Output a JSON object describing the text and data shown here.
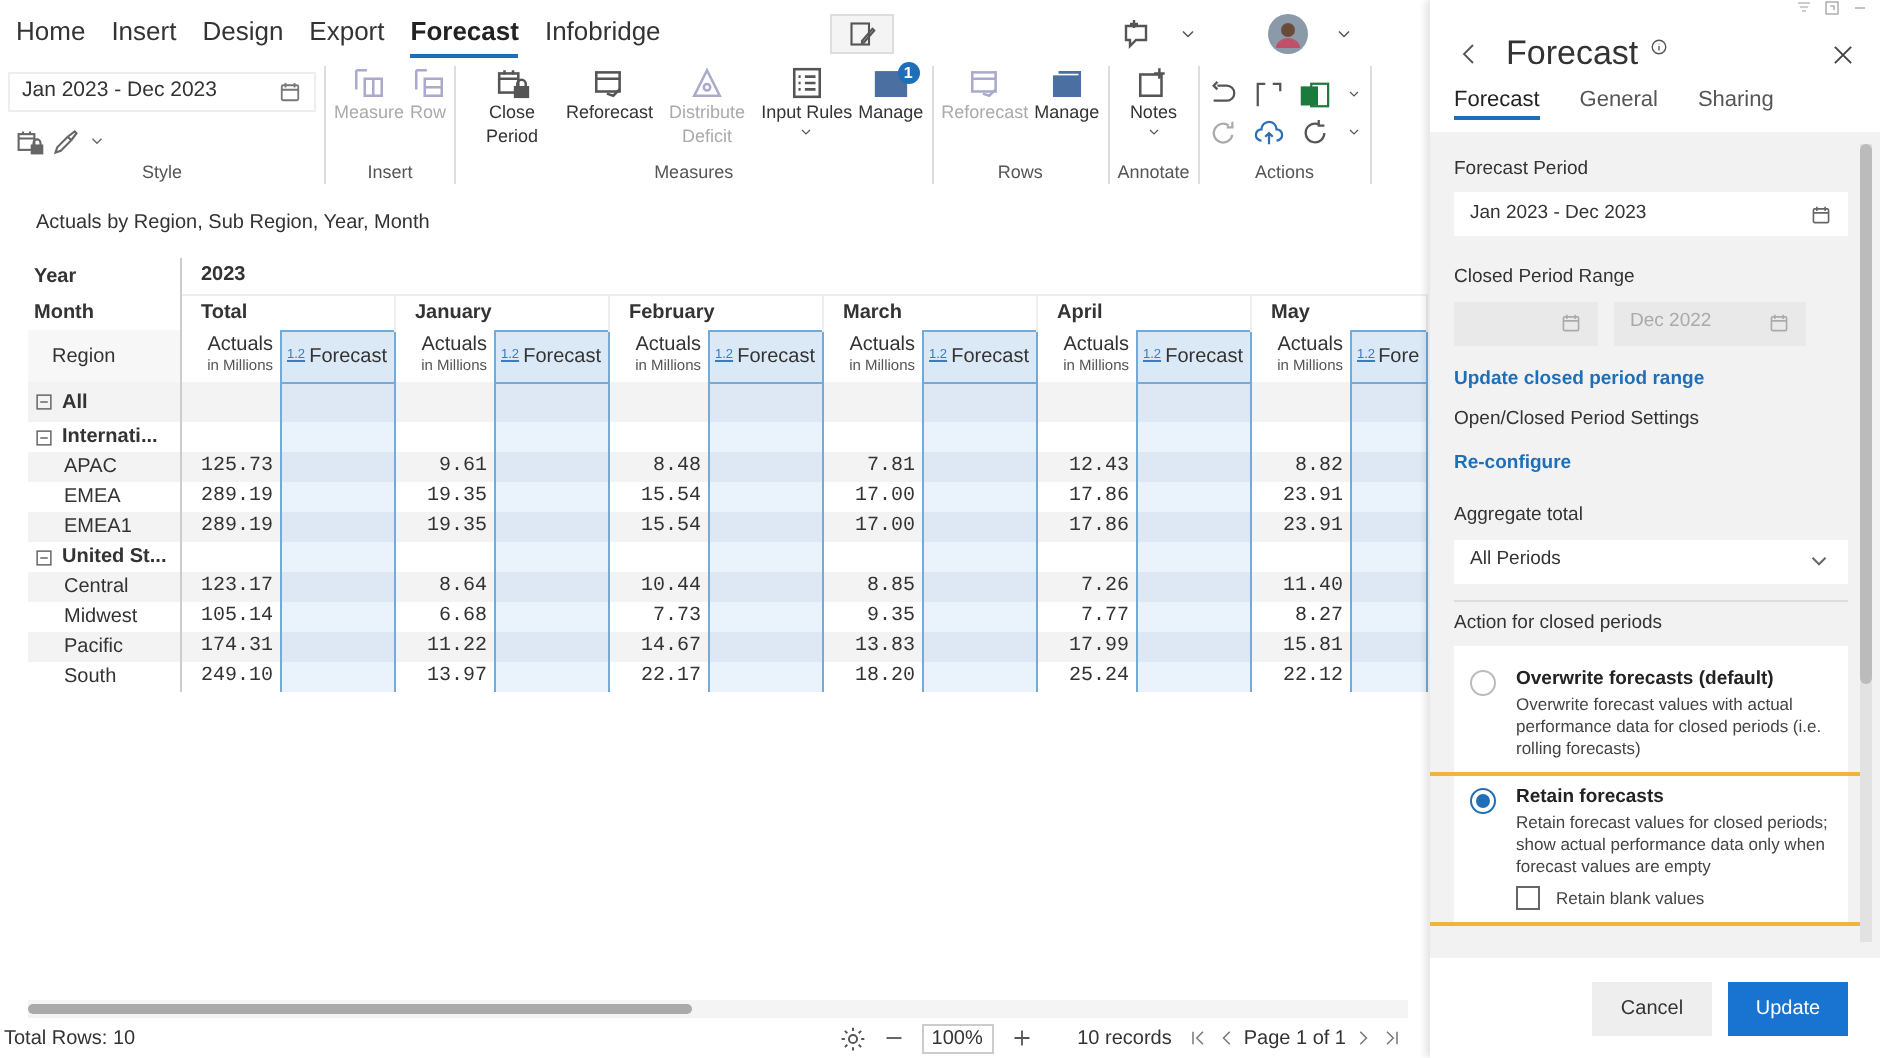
{
  "ribbon": {
    "tabs": [
      {
        "label": "Home",
        "selected": false
      },
      {
        "label": "Insert",
        "selected": false
      },
      {
        "label": "Design",
        "selected": false
      },
      {
        "label": "Export",
        "selected": false
      },
      {
        "label": "Forecast",
        "selected": true
      },
      {
        "label": "Infobridge",
        "selected": false
      }
    ],
    "groups": [
      {
        "kind": "style",
        "label": "Style",
        "date_range": "Jan 2023 - Dec 2023"
      },
      {
        "kind": "buttons",
        "label": "Insert",
        "buttons": [
          {
            "label": "Measure",
            "disabled": true
          },
          {
            "label": "Row",
            "disabled": true
          }
        ]
      },
      {
        "kind": "buttons",
        "label": "Measures",
        "buttons": [
          {
            "label": "Close Period",
            "disabled": false
          },
          {
            "label": "Reforecast",
            "disabled": false
          },
          {
            "label": "Distribute Deficit",
            "disabled": true
          },
          {
            "label": "Input Rules",
            "disabled": false,
            "dropdown": true
          },
          {
            "label": "Manage",
            "disabled": false,
            "badge": "1"
          }
        ]
      },
      {
        "kind": "buttons",
        "label": "Rows",
        "buttons": [
          {
            "label": "Reforecast",
            "disabled": true
          },
          {
            "label": "Manage",
            "disabled": false
          }
        ]
      },
      {
        "kind": "buttons",
        "label": "Annotate",
        "buttons": [
          {
            "label": "Notes",
            "disabled": false,
            "dropdown": true
          }
        ]
      },
      {
        "kind": "actions",
        "label": "Actions"
      }
    ]
  },
  "report": {
    "title": "Actuals by Region, Sub Region, Year, Month",
    "year_label": "Year",
    "year": "2023",
    "month_label": "Month",
    "region_label": "Region",
    "months": [
      {
        "name": "Total",
        "actuals": "Actuals",
        "unit": "in Millions",
        "format": "1.2",
        "forecast": "Forecast"
      },
      {
        "name": "January",
        "actuals": "Actuals",
        "unit": "in Millions",
        "format": "1.2",
        "forecast": "Forecast"
      },
      {
        "name": "February",
        "actuals": "Actuals",
        "unit": "in Millions",
        "format": "1.2",
        "forecast": "Forecast"
      },
      {
        "name": "March",
        "actuals": "Actuals",
        "unit": "in Millions",
        "format": "1.2",
        "forecast": "Forecast"
      },
      {
        "name": "April",
        "actuals": "Actuals",
        "unit": "in Millions",
        "format": "1.2",
        "forecast": "Forecast"
      },
      {
        "name": "May",
        "actuals": "Actuals",
        "unit": "in Millions",
        "format": "1.2",
        "forecast": "Fore"
      }
    ],
    "rows": [
      {
        "label": "All",
        "kind": "group",
        "expanded": true
      },
      {
        "label": "Internati...",
        "kind": "group",
        "expanded": true
      },
      {
        "label": "APAC",
        "kind": "leaf",
        "values": [
          "125.73",
          "9.61",
          "8.48",
          "7.81",
          "12.43",
          "8.82"
        ]
      },
      {
        "label": "EMEA",
        "kind": "leaf",
        "values": [
          "289.19",
          "19.35",
          "15.54",
          "17.00",
          "17.86",
          "23.91"
        ]
      },
      {
        "label": "EMEA1",
        "kind": "leaf",
        "values": [
          "289.19",
          "19.35",
          "15.54",
          "17.00",
          "17.86",
          "23.91"
        ]
      },
      {
        "label": "United St...",
        "kind": "group",
        "expanded": true
      },
      {
        "label": "Central",
        "kind": "leaf",
        "values": [
          "123.17",
          "8.64",
          "10.44",
          "8.85",
          "7.26",
          "11.40"
        ]
      },
      {
        "label": "Midwest",
        "kind": "leaf",
        "values": [
          "105.14",
          "6.68",
          "7.73",
          "9.35",
          "7.77",
          "8.27"
        ]
      },
      {
        "label": "Pacific",
        "kind": "leaf",
        "values": [
          "174.31",
          "11.22",
          "14.67",
          "13.83",
          "17.99",
          "15.81"
        ]
      },
      {
        "label": "South",
        "kind": "leaf",
        "values": [
          "249.10",
          "13.97",
          "22.17",
          "18.20",
          "25.24",
          "22.12"
        ]
      }
    ]
  },
  "status_bar": {
    "total_rows": "Total Rows: 10",
    "zoom": "100%",
    "records": "10 records",
    "page": "Page 1 of 1"
  },
  "panel": {
    "title": "Forecast",
    "tabs": [
      {
        "label": "Forecast",
        "selected": true
      },
      {
        "label": "General",
        "selected": false
      },
      {
        "label": "Sharing",
        "selected": false
      }
    ],
    "forecast_period": {
      "label": "Forecast Period",
      "value": "Jan 2023 - Dec 2023"
    },
    "closed_period": {
      "label": "Closed Period Range",
      "disabled": true,
      "end_value": "Dec 2022"
    },
    "update_link": "Update closed period range",
    "settings_label": "Open/Closed Period Settings",
    "reconfigure_link": "Re-configure",
    "aggregate": {
      "label": "Aggregate total",
      "value": "All Periods"
    },
    "action": {
      "label": "Action for closed periods",
      "options": [
        {
          "title": "Overwrite forecasts (default)",
          "description": "Overwrite forecast values with actual performance data for closed periods (i.e. rolling forecasts)",
          "selected": false
        },
        {
          "title": "Retain forecasts",
          "description": "Retain forecast values for closed periods; show actual performance data only when forecast values are empty",
          "selected": true,
          "highlighted": true,
          "checkbox": {
            "label": "Retain blank values",
            "checked": false
          }
        }
      ]
    },
    "buttons": [
      {
        "label": "Cancel",
        "kind": "secondary"
      },
      {
        "label": "Update",
        "kind": "primary"
      }
    ]
  }
}
